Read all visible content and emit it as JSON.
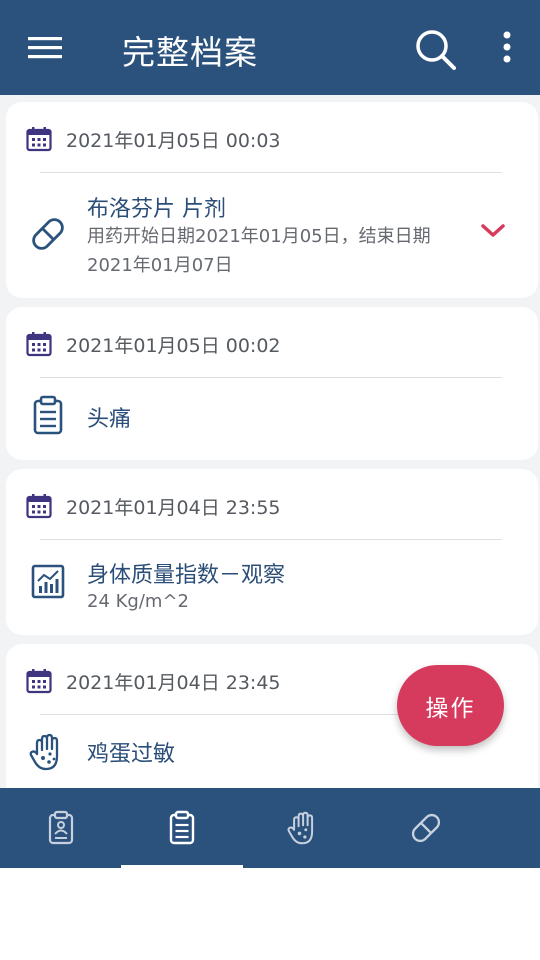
{
  "header": {
    "title": "完整档案",
    "menu_icon": "menu-icon",
    "search_icon": "search-icon",
    "more_icon": "more-vert-icon"
  },
  "records": [
    {
      "date": "2021年01月05日 00:03",
      "icon": "pill-icon",
      "title": "布洛芬片 片剂",
      "subtitle": "用药开始日期2021年01月05日，结束日期2021年01月07日",
      "expand_icon": "chevron-down-icon"
    },
    {
      "date": "2021年01月05日 00:02",
      "icon": "clipboard-icon",
      "title": "头痛"
    },
    {
      "date": "2021年01月04日 23:55",
      "icon": "chart-icon",
      "title": "身体质量指数－观察",
      "subtitle": "24 Kg/m^2"
    },
    {
      "date": "2021年01月04日 23:45",
      "icon": "allergy-hand-icon",
      "title": "鸡蛋过敏"
    }
  ],
  "fab": {
    "label": "操作"
  },
  "bottom_nav": [
    {
      "icon": "profile-clipboard-icon",
      "selected": false
    },
    {
      "icon": "clipboard-icon",
      "selected": true
    },
    {
      "icon": "allergy-hand-icon",
      "selected": false
    },
    {
      "icon": "pill-icon",
      "selected": false
    }
  ],
  "colors": {
    "primary": "#2b527d",
    "accent": "#d63a5d",
    "calendar": "#3e3480",
    "background": "#f2f3f5"
  }
}
